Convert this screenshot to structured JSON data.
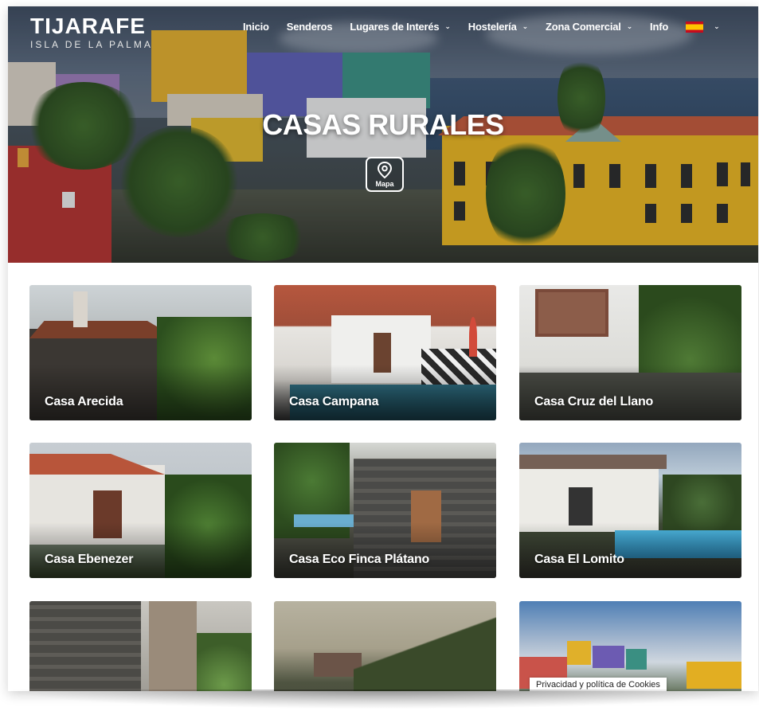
{
  "brand": {
    "name": "TIJARAFE",
    "tagline": "ISLA DE LA PALMA"
  },
  "nav": {
    "items": [
      {
        "label": "Inicio",
        "has_dropdown": false
      },
      {
        "label": "Senderos",
        "has_dropdown": false
      },
      {
        "label": "Lugares de Interés",
        "has_dropdown": true
      },
      {
        "label": "Hostelería",
        "has_dropdown": true
      },
      {
        "label": "Zona Comercial",
        "has_dropdown": true
      },
      {
        "label": "Info",
        "has_dropdown": false
      }
    ],
    "language_icon": "spain-flag-icon",
    "chevron_icon": "chevron-down-icon"
  },
  "hero": {
    "title": "CASAS RURALES",
    "map_button_label": "Mapa",
    "map_icon": "map-pin-icon"
  },
  "cards": [
    {
      "name": "Casa Arecida"
    },
    {
      "name": "Casa Campana"
    },
    {
      "name": "Casa Cruz del Llano"
    },
    {
      "name": "Casa Ebenezer"
    },
    {
      "name": "Casa Eco Finca Plátano"
    },
    {
      "name": "Casa El Lomito"
    },
    {
      "name": ""
    },
    {
      "name": ""
    },
    {
      "name": ""
    }
  ],
  "cookie_notice": "Privacidad y política de Cookies",
  "colors": {
    "hero_building_yellow": "#e8b420",
    "roof_terracotta": "#c2583a",
    "flag_red": "#c60b1e",
    "flag_yellow": "#ffc400"
  }
}
